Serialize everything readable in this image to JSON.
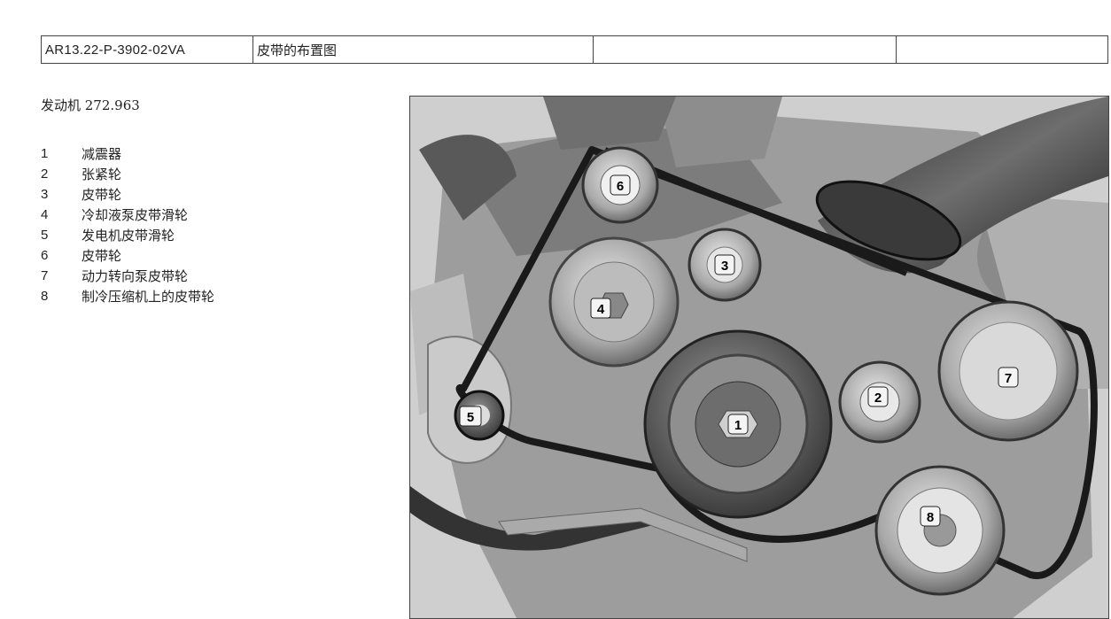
{
  "header": {
    "doc_id": "AR13.22-P-3902-02VA",
    "title": "皮带的布置图",
    "col3": "",
    "col4": ""
  },
  "engine": {
    "label": "发动机 272.963"
  },
  "legend": [
    {
      "num": "1",
      "text": "减震器"
    },
    {
      "num": "2",
      "text": "张紧轮"
    },
    {
      "num": "3",
      "text": "皮带轮"
    },
    {
      "num": "4",
      "text": "冷却液泵皮带滑轮"
    },
    {
      "num": "5",
      "text": "发电机皮带滑轮"
    },
    {
      "num": "6",
      "text": "皮带轮"
    },
    {
      "num": "7",
      "text": "动力转向泵皮带轮"
    },
    {
      "num": "8",
      "text": "制冷压缩机上的皮带轮"
    }
  ],
  "figure": {
    "callouts": [
      "1",
      "2",
      "3",
      "4",
      "5",
      "6",
      "7",
      "8"
    ]
  }
}
